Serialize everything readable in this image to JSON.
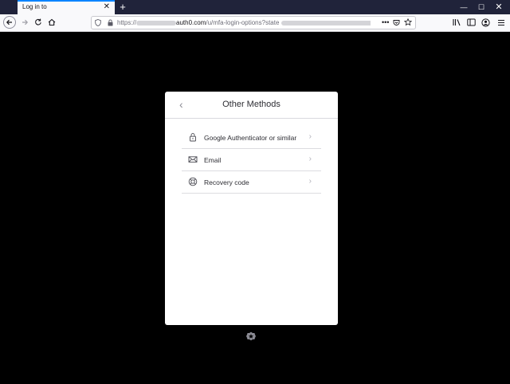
{
  "browser": {
    "tab_title": "Log in to",
    "tab_close": "✕",
    "new_tab": "+",
    "window": {
      "minimize": "—",
      "maximize": "☐",
      "close": "✕"
    },
    "url": {
      "scheme": "https://",
      "domain": "auth0.com",
      "path": "/u/mfa-login-options?state",
      "more": "•••"
    }
  },
  "modal": {
    "back": "‹",
    "title": "Other Methods",
    "methods": [
      {
        "label": "Google Authenticator or similar",
        "icon": "lock-icon"
      },
      {
        "label": "Email",
        "icon": "envelope-icon"
      },
      {
        "label": "Recovery code",
        "icon": "lifebuoy-icon"
      }
    ],
    "chevron": "›"
  },
  "colors": {
    "page_bg": "#000000",
    "card_bg": "#ffffff",
    "titlebar_bg": "#20233a",
    "tab_accent": "#0a84ff"
  }
}
